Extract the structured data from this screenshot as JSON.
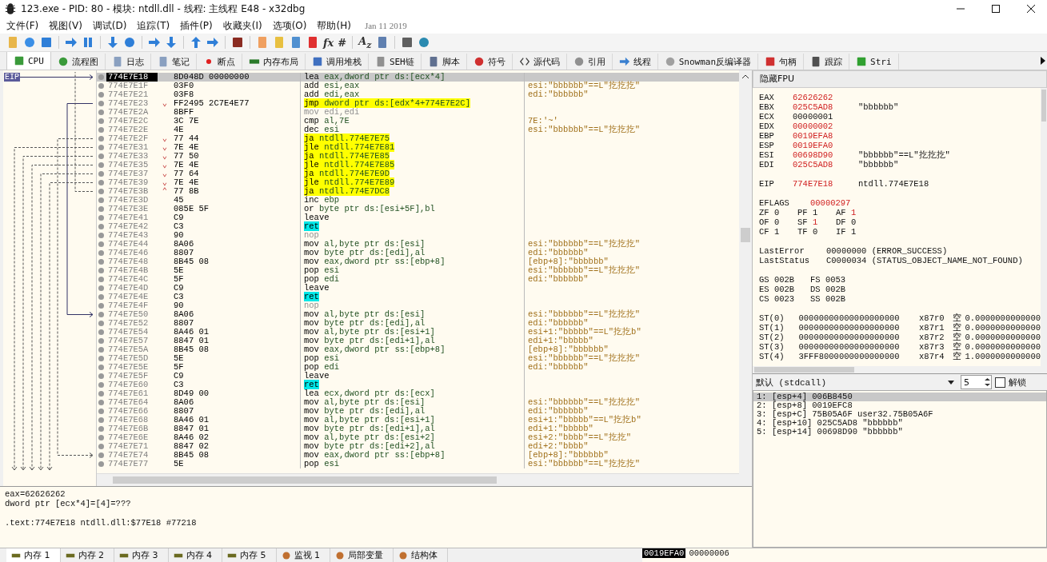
{
  "window": {
    "title": "123.exe - PID: 80 - 模块: ntdll.dll - 线程: 主线程 E48 - x32dbg"
  },
  "menu": {
    "items": [
      "文件(F)",
      "视图(V)",
      "调试(D)",
      "追踪(T)",
      "插件(P)",
      "收藏夹(I)",
      "选项(O)",
      "帮助(H)"
    ],
    "build_date": "Jan 11 2019"
  },
  "toolbar_glyphs": [
    "fx",
    "#",
    "A$_{z}$"
  ],
  "tabs": [
    {
      "label": "CPU",
      "selected": true
    },
    {
      "label": "流程图",
      "selected": false
    },
    {
      "label": "日志",
      "selected": false
    },
    {
      "label": "笔记",
      "selected": false
    },
    {
      "label": "断点",
      "selected": false
    },
    {
      "label": "内存布局",
      "selected": false
    },
    {
      "label": "调用堆栈",
      "selected": false
    },
    {
      "label": "SEH链",
      "selected": false
    },
    {
      "label": "脚本",
      "selected": false
    },
    {
      "label": "符号",
      "selected": false
    },
    {
      "label": "源代码",
      "selected": false
    },
    {
      "label": "引用",
      "selected": false
    },
    {
      "label": "线程",
      "selected": false
    },
    {
      "label": "Snowman反编译器",
      "selected": false
    },
    {
      "label": "句柄",
      "selected": false
    },
    {
      "label": "跟踪",
      "selected": false
    },
    {
      "label": "Stri",
      "selected": false
    }
  ],
  "disassembly": {
    "eip_label": "EIP",
    "rows": [
      {
        "address": "774E7E18",
        "bytes": "8D048D 00000000",
        "kind": "normal",
        "mnemonic": "lea",
        "operands": "eax,dword ptr ds:[ecx*4]",
        "selected": true
      },
      {
        "address": "774E7E1F",
        "bytes": "03F0",
        "kind": "normal",
        "mnemonic": "add",
        "operands": "esi,eax",
        "comment": "esi:\"bbbbbb\"==L\"扢扢扢\"",
        "selected": false
      },
      {
        "address": "774E7E21",
        "bytes": "03F8",
        "kind": "normal",
        "mnemonic": "add",
        "operands": "edi,eax",
        "comment": "edi:\"bbbbbb\"",
        "selected": false
      },
      {
        "address": "774E7E23",
        "branch": "⌄",
        "bytes": "FF2495 2C7E4E77",
        "kind": "jump",
        "mnemonic": "jmp",
        "operands": "dword ptr ds:[edx*4+774E7E2C]",
        "selected": false
      },
      {
        "address": "774E7E2A",
        "bytes": "8BFF",
        "kind": "filler",
        "mnemonic": "mov",
        "operands": "edi,edi",
        "selected": false
      },
      {
        "address": "774E7E2C",
        "bytes": "3C 7E",
        "kind": "normal",
        "mnemonic": "cmp",
        "operands": "al,7E",
        "comment": "7E:'~'",
        "selected": false
      },
      {
        "address": "774E7E2E",
        "bytes": "4E",
        "kind": "normal",
        "mnemonic": "dec",
        "operands": "esi",
        "comment": "esi:\"bbbbbb\"==L\"扢扢扢\"",
        "selected": false
      },
      {
        "address": "774E7E2F",
        "branch": "⌄",
        "bytes": "77 44",
        "kind": "jump",
        "mnemonic": "ja",
        "operands": "ntdll.774E7E75",
        "selected": false
      },
      {
        "address": "774E7E31",
        "branch": "⌄",
        "bytes": "7E 4E",
        "kind": "jump",
        "mnemonic": "jle",
        "operands": "ntdll.774E7E81",
        "selected": false
      },
      {
        "address": "774E7E33",
        "branch": "⌄",
        "bytes": "77 50",
        "kind": "jump",
        "mnemonic": "ja",
        "operands": "ntdll.774E7E85",
        "selected": false
      },
      {
        "address": "774E7E35",
        "branch": "⌄",
        "bytes": "7E 4E",
        "kind": "jump",
        "mnemonic": "jle",
        "operands": "ntdll.774E7E85",
        "selected": false
      },
      {
        "address": "774E7E37",
        "branch": "⌄",
        "bytes": "77 64",
        "kind": "jump",
        "mnemonic": "ja",
        "operands": "ntdll.774E7E9D",
        "selected": false
      },
      {
        "address": "774E7E39",
        "branch": "⌄",
        "bytes": "7E 4E",
        "kind": "jump",
        "mnemonic": "jle",
        "operands": "ntdll.774E7E89",
        "selected": false
      },
      {
        "address": "774E7E3B",
        "branch": "⌃",
        "bytes": "77 8B",
        "kind": "jump",
        "mnemonic": "ja",
        "operands": "ntdll.774E7DC8",
        "selected": false
      },
      {
        "address": "774E7E3D",
        "bytes": "45",
        "kind": "normal",
        "mnemonic": "inc",
        "operands": "ebp",
        "selected": false
      },
      {
        "address": "774E7E3E",
        "bytes": "085E 5F",
        "kind": "normal",
        "mnemonic": "or",
        "operands": "byte ptr ds:[esi+5F],bl",
        "selected": false
      },
      {
        "address": "774E7E41",
        "bytes": "C9",
        "kind": "normal",
        "mnemonic": "leave",
        "operands": "",
        "selected": false
      },
      {
        "address": "774E7E42",
        "bytes": "C3",
        "kind": "ret",
        "mnemonic": "ret",
        "operands": "",
        "selected": false
      },
      {
        "address": "774E7E43",
        "bytes": "90",
        "kind": "filler",
        "mnemonic": "nop",
        "operands": "",
        "selected": false
      },
      {
        "address": "774E7E44",
        "bytes": "8A06",
        "kind": "normal",
        "mnemonic": "mov",
        "operands": "al,byte ptr ds:[esi]",
        "comment": "esi:\"bbbbbb\"==L\"扢扢扢\"",
        "selected": false
      },
      {
        "address": "774E7E46",
        "bytes": "8807",
        "kind": "normal",
        "mnemonic": "mov",
        "operands": "byte ptr ds:[edi],al",
        "comment": "edi:\"bbbbbb\"",
        "selected": false
      },
      {
        "address": "774E7E48",
        "bytes": "8B45 08",
        "kind": "normal",
        "mnemonic": "mov",
        "operands": "eax,dword ptr ss:[ebp+8]",
        "comment": "[ebp+8]:\"bbbbbb\"",
        "selected": false
      },
      {
        "address": "774E7E4B",
        "bytes": "5E",
        "kind": "normal",
        "mnemonic": "pop",
        "operands": "esi",
        "comment": "esi:\"bbbbbb\"==L\"扢扢扢\"",
        "selected": false
      },
      {
        "address": "774E7E4C",
        "bytes": "5F",
        "kind": "normal",
        "mnemonic": "pop",
        "operands": "edi",
        "comment": "edi:\"bbbbbb\"",
        "selected": false
      },
      {
        "address": "774E7E4D",
        "bytes": "C9",
        "kind": "normal",
        "mnemonic": "leave",
        "operands": "",
        "selected": false
      },
      {
        "address": "774E7E4E",
        "bytes": "C3",
        "kind": "ret",
        "mnemonic": "ret",
        "operands": "",
        "selected": false
      },
      {
        "address": "774E7E4F",
        "bytes": "90",
        "kind": "filler",
        "mnemonic": "nop",
        "operands": "",
        "selected": false
      },
      {
        "address": "774E7E50",
        "bytes": "8A06",
        "kind": "normal",
        "mnemonic": "mov",
        "operands": "al,byte ptr ds:[esi]",
        "comment": "esi:\"bbbbbb\"==L\"扢扢扢\"",
        "selected": false
      },
      {
        "address": "774E7E52",
        "bytes": "8807",
        "kind": "normal",
        "mnemonic": "mov",
        "operands": "byte ptr ds:[edi],al",
        "comment": "edi:\"bbbbbb\"",
        "selected": false
      },
      {
        "address": "774E7E54",
        "bytes": "8A46 01",
        "kind": "normal",
        "mnemonic": "mov",
        "operands": "al,byte ptr ds:[esi+1]",
        "comment": "esi+1:\"bbbbb\"==L\"扢扢b\"",
        "selected": false
      },
      {
        "address": "774E7E57",
        "bytes": "8847 01",
        "kind": "normal",
        "mnemonic": "mov",
        "operands": "byte ptr ds:[edi+1],al",
        "comment": "edi+1:\"bbbbb\"",
        "selected": false
      },
      {
        "address": "774E7E5A",
        "bytes": "8B45 08",
        "kind": "normal",
        "mnemonic": "mov",
        "operands": "eax,dword ptr ss:[ebp+8]",
        "comment": "[ebp+8]:\"bbbbbb\"",
        "selected": false
      },
      {
        "address": "774E7E5D",
        "bytes": "5E",
        "kind": "normal",
        "mnemonic": "pop",
        "operands": "esi",
        "comment": "esi:\"bbbbbb\"==L\"扢扢扢\"",
        "selected": false
      },
      {
        "address": "774E7E5E",
        "bytes": "5F",
        "kind": "normal",
        "mnemonic": "pop",
        "operands": "edi",
        "comment": "edi:\"bbbbbb\"",
        "selected": false
      },
      {
        "address": "774E7E5F",
        "bytes": "C9",
        "kind": "normal",
        "mnemonic": "leave",
        "operands": "",
        "selected": false
      },
      {
        "address": "774E7E60",
        "bytes": "C3",
        "kind": "ret",
        "mnemonic": "ret",
        "operands": "",
        "selected": false
      },
      {
        "address": "774E7E61",
        "bytes": "8D49 00",
        "kind": "normal",
        "mnemonic": "lea",
        "operands": "ecx,dword ptr ds:[ecx]",
        "selected": false
      },
      {
        "address": "774E7E64",
        "bytes": "8A06",
        "kind": "normal",
        "mnemonic": "mov",
        "operands": "al,byte ptr ds:[esi]",
        "comment": "esi:\"bbbbbb\"==L\"扢扢扢\"",
        "selected": false
      },
      {
        "address": "774E7E66",
        "bytes": "8807",
        "kind": "normal",
        "mnemonic": "mov",
        "operands": "byte ptr ds:[edi],al",
        "comment": "edi:\"bbbbbb\"",
        "selected": false
      },
      {
        "address": "774E7E68",
        "bytes": "8A46 01",
        "kind": "normal",
        "mnemonic": "mov",
        "operands": "al,byte ptr ds:[esi+1]",
        "comment": "esi+1:\"bbbbb\"==L\"扢扢b\"",
        "selected": false
      },
      {
        "address": "774E7E6B",
        "bytes": "8847 01",
        "kind": "normal",
        "mnemonic": "mov",
        "operands": "byte ptr ds:[edi+1],al",
        "comment": "edi+1:\"bbbbb\"",
        "selected": false
      },
      {
        "address": "774E7E6E",
        "bytes": "8A46 02",
        "kind": "normal",
        "mnemonic": "mov",
        "operands": "al,byte ptr ds:[esi+2]",
        "comment": "esi+2:\"bbbb\"==L\"扢扢\"",
        "selected": false
      },
      {
        "address": "774E7E71",
        "bytes": "8847 02",
        "kind": "normal",
        "mnemonic": "mov",
        "operands": "byte ptr ds:[edi+2],al",
        "comment": "edi+2:\"bbbb\"",
        "selected": false
      },
      {
        "address": "774E7E74",
        "bytes": "8B45 08",
        "kind": "normal",
        "mnemonic": "mov",
        "operands": "eax,dword ptr ss:[ebp+8]",
        "comment": "[ebp+8]:\"bbbbbb\"",
        "selected": false
      },
      {
        "address": "774E7E77",
        "bytes": "5E",
        "kind": "normal",
        "mnemonic": "pop",
        "operands": "esi",
        "comment": "esi:\"bbbbbb\"==L\"扢扢扢\"",
        "selected": false
      }
    ]
  },
  "info": {
    "lines": [
      "eax=62626262",
      "dword ptr [ecx*4]=[4]=???"
    ],
    "location": ".text:774E7E18 ntdll.dll:$77E18 #77218"
  },
  "registers": {
    "header": "隐藏FPU",
    "general": [
      {
        "name": "EAX",
        "value": "62626262",
        "changed": true
      },
      {
        "name": "EBX",
        "value": "025C5AD8",
        "changed": true,
        "comment": "\"bbbbbb\""
      },
      {
        "name": "ECX",
        "value": "00000001",
        "changed": false
      },
      {
        "name": "EDX",
        "value": "00000002",
        "changed": true
      },
      {
        "name": "EBP",
        "value": "0019EFA8",
        "changed": true
      },
      {
        "name": "ESP",
        "value": "0019EFA0",
        "changed": true
      },
      {
        "name": "ESI",
        "value": "00698D90",
        "changed": true,
        "comment": "\"bbbbbb\"==L\"扢扢扢\""
      },
      {
        "name": "EDI",
        "value": "025C5AD8",
        "changed": true,
        "comment": "\"bbbbbb\""
      }
    ],
    "eip": {
      "name": "EIP",
      "value": "774E7E18",
      "changed": true,
      "comment": "ntdll.774E7E18"
    },
    "eflags": {
      "name": "EFLAGS",
      "value": "00000297",
      "changed": true
    },
    "flag_rows": [
      [
        {
          "name": "ZF",
          "value": "0",
          "changed": false
        },
        {
          "name": "PF",
          "value": "1",
          "changed": false
        },
        {
          "name": "AF",
          "value": "1",
          "changed": true
        }
      ],
      [
        {
          "name": "OF",
          "value": "0",
          "changed": false
        },
        {
          "name": "SF",
          "value": "1",
          "changed": true
        },
        {
          "name": "DF",
          "value": "0",
          "changed": false
        }
      ],
      [
        {
          "name": "CF",
          "value": "1",
          "changed": false
        },
        {
          "name": "TF",
          "value": "0",
          "changed": false
        },
        {
          "name": "IF",
          "value": "1",
          "changed": false
        }
      ]
    ],
    "last_error": {
      "name": "LastError",
      "value": "00000000 (ERROR_SUCCESS)"
    },
    "last_status": {
      "name": "LastStatus",
      "value": "C0000034 (STATUS_OBJECT_NAME_NOT_FOUND)"
    },
    "segment_rows": [
      [
        {
          "name": "GS",
          "value": "002B"
        },
        {
          "name": "FS",
          "value": "0053"
        }
      ],
      [
        {
          "name": "ES",
          "value": "002B"
        },
        {
          "name": "DS",
          "value": "002B"
        }
      ],
      [
        {
          "name": "CS",
          "value": "0023"
        },
        {
          "name": "SS",
          "value": "002B"
        }
      ]
    ],
    "fpu": [
      {
        "name": "ST(0)",
        "raw": "00000000000000000000",
        "reg": "x87r0",
        "tag": "空",
        "value": "0.0000000000000"
      },
      {
        "name": "ST(1)",
        "raw": "00000000000000000000",
        "reg": "x87r1",
        "tag": "空",
        "value": "0.0000000000000"
      },
      {
        "name": "ST(2)",
        "raw": "00000000000000000000",
        "reg": "x87r2",
        "tag": "空",
        "value": "0.0000000000000"
      },
      {
        "name": "ST(3)",
        "raw": "00000000000000000000",
        "reg": "x87r3",
        "tag": "空",
        "value": "0.0000000000000"
      },
      {
        "name": "ST(4)",
        "raw": "3FFF8000000000000000",
        "reg": "x87r4",
        "tag": "空",
        "value": "1.0000000000000"
      }
    ]
  },
  "arguments": {
    "convention": "默认 (stdcall)",
    "count": "5",
    "unlock": {
      "label": "解锁",
      "checked": false
    },
    "items": [
      {
        "text": "1: [esp+4] 006B8450",
        "selected": true
      },
      {
        "text": "2: [esp+8] 0019EFC8",
        "selected": false
      },
      {
        "text": "3: [esp+C] 75B05A6F user32.75B05A6F",
        "selected": false
      },
      {
        "text": "4: [esp+10] 025C5AD8 \"bbbbbb\"",
        "selected": false
      },
      {
        "text": "5: [esp+14] 00698D90 \"bbbbbb\"",
        "selected": false
      }
    ]
  },
  "bottom_tabs": [
    {
      "label": "内存 1",
      "selected": true
    },
    {
      "label": "内存 2",
      "selected": false
    },
    {
      "label": "内存 3",
      "selected": false
    },
    {
      "label": "内存 4",
      "selected": false
    },
    {
      "label": "内存 5",
      "selected": false
    },
    {
      "label": "监视 1",
      "selected": false
    },
    {
      "label": "局部变量",
      "selected": false
    },
    {
      "label": "结构体",
      "selected": false
    }
  ],
  "stack": {
    "address": "0019EFA0",
    "value": "00000006"
  }
}
